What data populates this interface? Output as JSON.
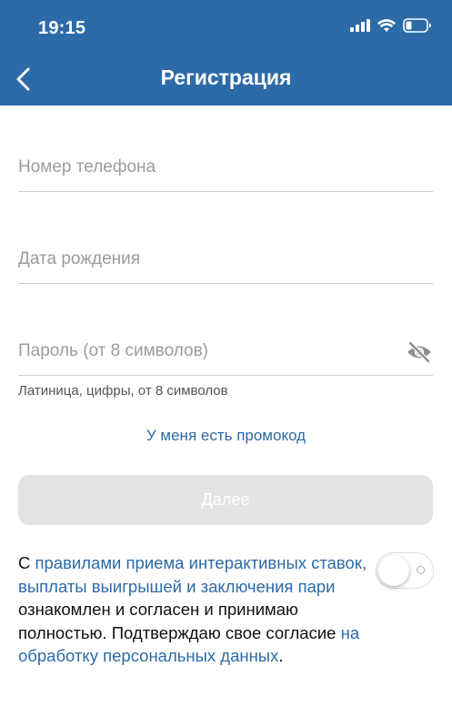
{
  "status_bar": {
    "time": "19:15"
  },
  "header": {
    "title": "Регистрация",
    "back_icon": "chevron-left-icon"
  },
  "form": {
    "phone": {
      "placeholder": "Номер телефона",
      "value": ""
    },
    "birthdate": {
      "placeholder": "Дата рождения",
      "value": ""
    },
    "password": {
      "placeholder": "Пароль (от 8 символов)",
      "value": "",
      "toggle_icon": "eye-off-icon"
    },
    "password_hint": "Латиница, цифры, от 8 символов",
    "promo_link": "У меня есть промокод",
    "next_label": "Далее"
  },
  "terms": {
    "prefix": "С ",
    "rules_link": "правилами приема интерактивных ставок, выплаты выигрышей и заключения пари",
    "middle": " ознакомлен и согласен и принимаю полностью. Подтверждаю свое согласие ",
    "data_link": "на обработку персональных данных",
    "suffix": ".",
    "toggle_state": "off"
  },
  "colors": {
    "header_bg": "#2d6aa8",
    "link": "#2d6aa8",
    "button_disabled_bg": "#e4e4e4",
    "divider": "#c9c9c9",
    "placeholder": "#9c9c9c"
  }
}
